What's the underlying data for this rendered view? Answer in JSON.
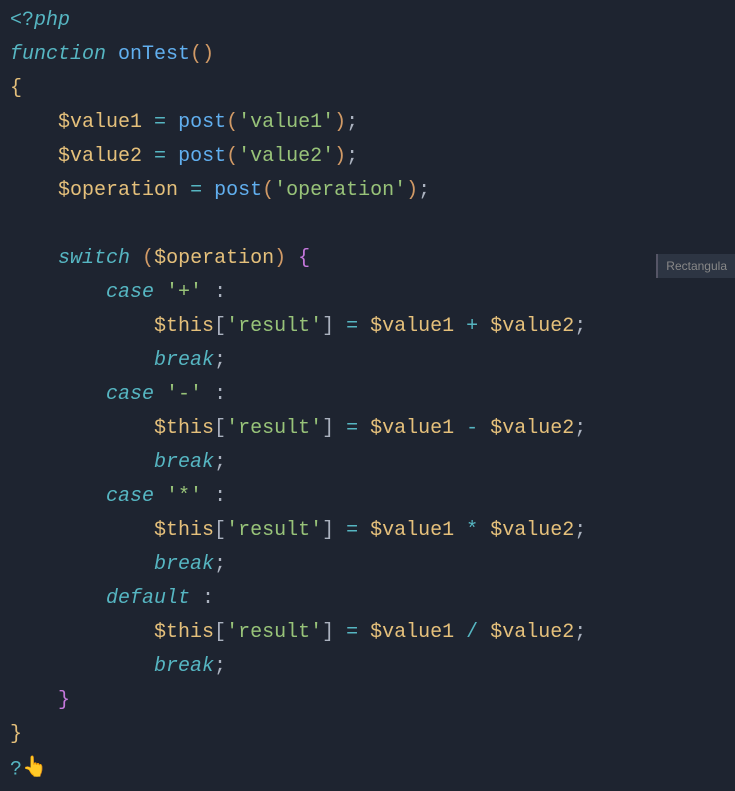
{
  "ghost_label": "Rectangula",
  "code": {
    "l1": {
      "open_tag": "<?",
      "php": "php"
    },
    "l2": {
      "kw": "function",
      "name": "onTest",
      "p_open": "(",
      "p_close": ")"
    },
    "l3": {
      "brace": "{"
    },
    "l4": {
      "var": "$value1",
      "eq": "=",
      "fn": "post",
      "po": "(",
      "str": "'value1'",
      "pc": ")",
      "sc": ";"
    },
    "l5": {
      "var": "$value2",
      "eq": "=",
      "fn": "post",
      "po": "(",
      "str": "'value2'",
      "pc": ")",
      "sc": ";"
    },
    "l6": {
      "var": "$operation",
      "eq": "=",
      "fn": "post",
      "po": "(",
      "str": "'operation'",
      "pc": ")",
      "sc": ";"
    },
    "l8": {
      "kw": "switch",
      "po": "(",
      "var": "$operation",
      "pc": ")",
      "brace": "{"
    },
    "l9": {
      "kw": "case",
      "str": "'+'",
      "colon": ":"
    },
    "l10": {
      "this": "$this",
      "bo": "[",
      "key": "'result'",
      "bc": "]",
      "eq": "=",
      "v1": "$value1",
      "op": "+",
      "v2": "$value2",
      "sc": ";"
    },
    "l11": {
      "kw": "break",
      "sc": ";"
    },
    "l12": {
      "kw": "case",
      "str": "'-'",
      "colon": ":"
    },
    "l13": {
      "this": "$this",
      "bo": "[",
      "key": "'result'",
      "bc": "]",
      "eq": "=",
      "v1": "$value1",
      "op": "-",
      "v2": "$value2",
      "sc": ";"
    },
    "l14": {
      "kw": "break",
      "sc": ";"
    },
    "l15": {
      "kw": "case",
      "str": "'*'",
      "colon": ":"
    },
    "l16": {
      "this": "$this",
      "bo": "[",
      "key": "'result'",
      "bc": "]",
      "eq": "=",
      "v1": "$value1",
      "op": "*",
      "v2": "$value2",
      "sc": ";"
    },
    "l17": {
      "kw": "break",
      "sc": ";"
    },
    "l18": {
      "kw": "default",
      "colon": ":"
    },
    "l19": {
      "this": "$this",
      "bo": "[",
      "key": "'result'",
      "bc": "]",
      "eq": "=",
      "v1": "$value1",
      "op": "/",
      "v2": "$value2",
      "sc": ";"
    },
    "l20": {
      "kw": "break",
      "sc": ";"
    },
    "l21": {
      "brace": "}"
    },
    "l22": {
      "brace": "}"
    },
    "l23": {
      "close_tag": "?"
    }
  }
}
